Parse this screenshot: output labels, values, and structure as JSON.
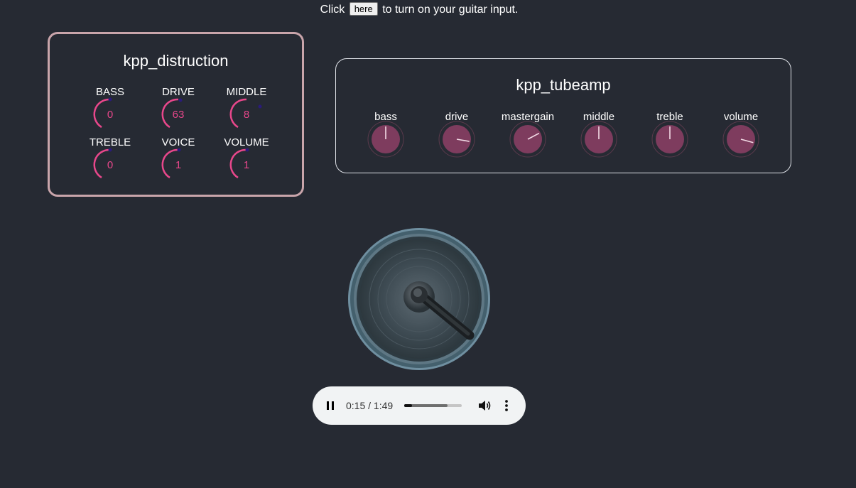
{
  "prompt": {
    "before": "Click",
    "button": "here",
    "after": "to turn on your guitar input."
  },
  "distortion": {
    "title": "kpp_distruction",
    "knobs": [
      {
        "label": "BASS",
        "value": "0"
      },
      {
        "label": "DRIVE",
        "value": "63"
      },
      {
        "label": "MIDDLE",
        "value": "8"
      },
      {
        "label": "TREBLE",
        "value": "0"
      },
      {
        "label": "VOICE",
        "value": "1"
      },
      {
        "label": "VOLUME",
        "value": "1"
      }
    ]
  },
  "tubeamp": {
    "title": "kpp_tubeamp",
    "knobs": [
      {
        "label": "bass",
        "level": 0.5
      },
      {
        "label": "drive",
        "level": 0.87
      },
      {
        "label": "mastergain",
        "level": 0.73
      },
      {
        "label": "middle",
        "level": 0.5
      },
      {
        "label": "treble",
        "level": 0.5
      },
      {
        "label": "volume",
        "level": 0.89
      }
    ]
  },
  "player": {
    "time": "0:15 / 1:49",
    "played": 0.14,
    "buffered": 0.75
  },
  "colors": {
    "background": "#262a33",
    "accent_pink": "#e8478b",
    "knob_fill": "#7e3c5e",
    "distortion_border": "#c9a5ab"
  },
  "icons": {
    "pause": "pause-icon",
    "volume": "volume-icon",
    "more": "more-vertical-icon"
  }
}
